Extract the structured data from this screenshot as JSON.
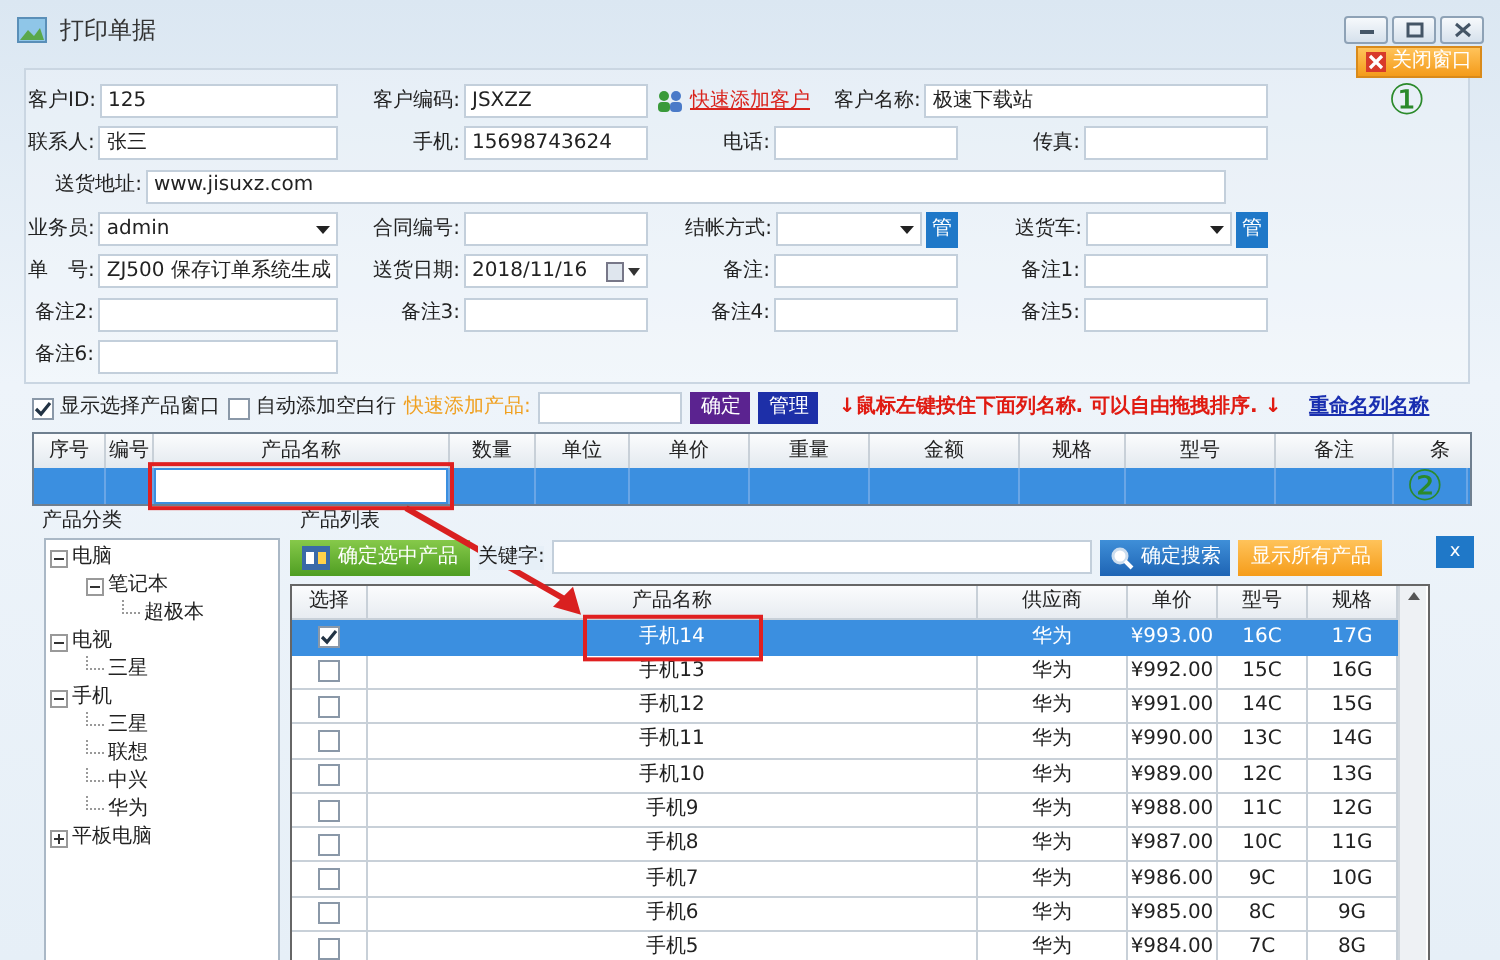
{
  "window": {
    "title": "打印单据",
    "close_button": "关闭窗口"
  },
  "form": {
    "rows": [
      [
        {
          "kind": "field",
          "label": "客户ID:",
          "value": "125"
        },
        {
          "kind": "field",
          "label": "客户编码:",
          "value": "JSXZZ"
        },
        {
          "kind": "link",
          "label": "快速添加客户"
        },
        {
          "kind": "field",
          "label": "客户名称:",
          "value": "极速下载站"
        }
      ],
      [
        {
          "kind": "field",
          "label": "联系人:",
          "value": "张三"
        },
        {
          "kind": "field",
          "label": "手机:",
          "value": "15698743624"
        },
        {
          "kind": "field",
          "label": "电话:"
        },
        {
          "kind": "field",
          "label": "传真:"
        }
      ],
      [
        {
          "kind": "wide",
          "label": "送货地址:",
          "value": "www.jisuxz.com"
        }
      ],
      [
        {
          "kind": "select",
          "label": "业务员:",
          "value": "admin"
        },
        {
          "kind": "field",
          "label": "合同编号:"
        },
        {
          "kind": "select",
          "label": "结帐方式:",
          "button": "管"
        },
        {
          "kind": "select",
          "label": "送货车:",
          "button": "管"
        }
      ],
      [
        {
          "kind": "field",
          "label": "单　号:",
          "value": "ZJ500 保存订单系统生成"
        },
        {
          "kind": "date",
          "label": "送货日期:",
          "value": "2018/11/16"
        },
        {
          "kind": "field",
          "label": "备注:"
        },
        {
          "kind": "field",
          "label": "备注1:"
        }
      ],
      [
        {
          "kind": "field",
          "label": "备注2:"
        },
        {
          "kind": "field",
          "label": "备注3:"
        },
        {
          "kind": "field",
          "label": "备注4:"
        },
        {
          "kind": "field",
          "label": "备注5:"
        }
      ],
      [
        {
          "kind": "field",
          "label": "备注6:"
        }
      ]
    ]
  },
  "toolbar": {
    "options": [
      {
        "label": "显示选择产品窗口",
        "checked": true
      },
      {
        "label": "自动添加空白行",
        "checked": false
      }
    ],
    "quick_add_label": "快速添加产品:",
    "buttons": [
      {
        "label": "确定",
        "kind": "confirm"
      },
      {
        "label": "管理",
        "kind": "manage"
      }
    ],
    "hint": "↓鼠标左键按住下面列名称. 可以自由拖拽排序. ↓",
    "link": "重命名列名称"
  },
  "order_grid": {
    "columns": [
      "序号",
      "编号",
      "产品名称",
      "数量",
      "单位",
      "单价",
      "重量",
      "金额",
      "规格",
      "型号",
      "备注",
      "条"
    ],
    "rows": [
      {
        "selected": true
      }
    ]
  },
  "categories": {
    "title": "产品分类",
    "items": [
      {
        "label": "电脑",
        "expanded": true,
        "children": [
          {
            "label": "笔记本",
            "expanded": true,
            "children": [
              {
                "label": "超极本"
              }
            ]
          }
        ]
      },
      {
        "label": "电视",
        "expanded": true,
        "children": [
          {
            "label": "三星"
          }
        ]
      },
      {
        "label": "手机",
        "expanded": true,
        "children": [
          {
            "label": "三星"
          },
          {
            "label": "联想"
          },
          {
            "label": "中兴"
          },
          {
            "label": "华为"
          }
        ]
      },
      {
        "label": "平板电脑",
        "expanded": false
      }
    ]
  },
  "products": {
    "title": "产品列表",
    "select_button": "确定选中产品",
    "keyword_label": "关键字:",
    "search_button": "确定搜索",
    "show_all_button": "显示所有产品",
    "hide_button": "x",
    "check_column": "选择",
    "columns": [
      "产品名称",
      "供应商",
      "单价",
      "型号",
      "规格"
    ],
    "rows": [
      {
        "checked": true,
        "selected": true,
        "cells": [
          "手机14",
          "华为",
          "¥993.00",
          "16C",
          "17G"
        ]
      },
      {
        "checked": false,
        "selected": false,
        "cells": [
          "手机13",
          "华为",
          "¥992.00",
          "15C",
          "16G"
        ]
      },
      {
        "checked": false,
        "selected": false,
        "cells": [
          "手机12",
          "华为",
          "¥991.00",
          "14C",
          "15G"
        ]
      },
      {
        "checked": false,
        "selected": false,
        "cells": [
          "手机11",
          "华为",
          "¥990.00",
          "13C",
          "14G"
        ]
      },
      {
        "checked": false,
        "selected": false,
        "cells": [
          "手机10",
          "华为",
          "¥989.00",
          "12C",
          "13G"
        ]
      },
      {
        "checked": false,
        "selected": false,
        "cells": [
          "手机9",
          "华为",
          "¥988.00",
          "11C",
          "12G"
        ]
      },
      {
        "checked": false,
        "selected": false,
        "cells": [
          "手机8",
          "华为",
          "¥987.00",
          "10C",
          "11G"
        ]
      },
      {
        "checked": false,
        "selected": false,
        "cells": [
          "手机7",
          "华为",
          "¥986.00",
          "9C",
          "10G"
        ]
      },
      {
        "checked": false,
        "selected": false,
        "cells": [
          "手机6",
          "华为",
          "¥985.00",
          "8C",
          "9G"
        ]
      },
      {
        "checked": false,
        "selected": false,
        "cells": [
          "手机5",
          "华为",
          "¥984.00",
          "7C",
          "8G"
        ]
      }
    ]
  },
  "annotations": [
    {
      "text": "①"
    },
    {
      "text": "②"
    }
  ]
}
